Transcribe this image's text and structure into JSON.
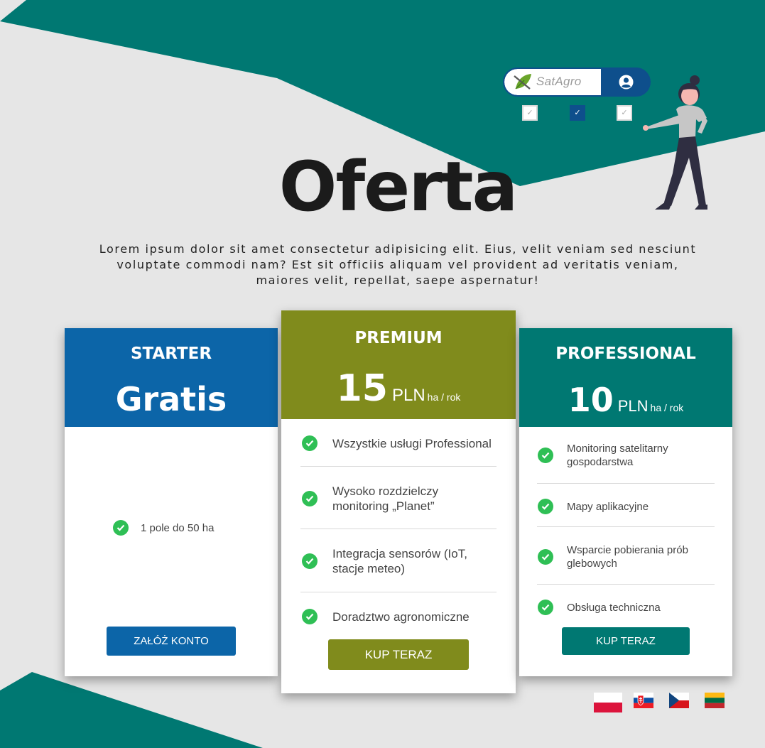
{
  "colors": {
    "teal": "#007872",
    "starter_blue": "#0c65a8",
    "premium_olive": "#808b1c",
    "check_green": "#2fbf55",
    "background": "#e6e6e6"
  },
  "header": {
    "logo_text": "SatAgro",
    "user_icon": "user-circle-icon",
    "checkboxes": [
      {
        "checked": false
      },
      {
        "checked": true
      },
      {
        "checked": false
      }
    ]
  },
  "hero": {
    "title": "Oferta",
    "lead": "Lorem ipsum dolor sit amet consectetur adipisicing elit. Eius, velit veniam sed nesciunt voluptate commodi nam? Est sit officiis aliquam vel provident ad veritatis veniam, maiores velit, repellat, saepe aspernatur!"
  },
  "plans": {
    "starter": {
      "name": "STARTER",
      "price": "Gratis",
      "features": [
        "1 pole do 50 ha"
      ],
      "button": "ZAŁÓŻ KONTO"
    },
    "premium": {
      "name": "PREMIUM",
      "price_amount": "15",
      "price_currency": "PLN",
      "price_unit": "ha / rok",
      "features": [
        "Wszystkie usługi Professional",
        "Wysoko rozdzielczy monitoring „Planet”",
        "Integracja sensorów (IoT, stacje meteo)",
        "Doradztwo agronomiczne"
      ],
      "button": "KUP TERAZ"
    },
    "professional": {
      "name": "PROFESSIONAL",
      "price_amount": "10",
      "price_currency": "PLN",
      "price_unit": "ha / rok",
      "features": [
        "Monitoring satelitarny gospodarstwa",
        "Mapy aplikacyjne",
        "Wsparcie pobierania prób glebowych",
        "Obsługa techniczna"
      ],
      "button": "KUP TERAZ"
    }
  },
  "languages": [
    {
      "icon": "flag-poland-icon"
    },
    {
      "icon": "flag-slovakia-icon"
    },
    {
      "icon": "flag-czech-icon"
    },
    {
      "icon": "flag-lithuania-icon"
    }
  ]
}
